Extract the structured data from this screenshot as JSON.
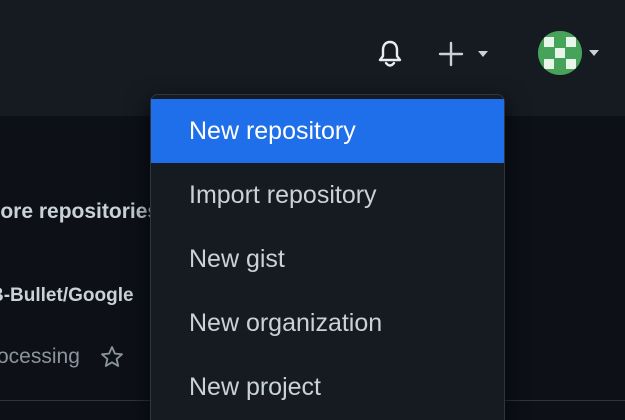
{
  "header": {
    "notifications_icon": "bell-icon",
    "create_icon": "plus-icon",
    "create_caret_icon": "caret-down-icon",
    "avatar_icon": "identicon-avatar",
    "avatar_caret_icon": "caret-down-icon"
  },
  "create_menu": {
    "items": [
      {
        "label": "New repository",
        "active": true
      },
      {
        "label": "Import repository"
      },
      {
        "label": "New gist"
      },
      {
        "label": "New organization"
      },
      {
        "label": "New project"
      }
    ]
  },
  "background": {
    "section_heading": "Explore repositories",
    "repo_name": "B-Bullet/Google",
    "repo_language": "Processing",
    "star_icon": "star-icon"
  },
  "colors": {
    "header_bg": "#161b22",
    "page_bg": "#0d1117",
    "menu_active": "#1f6feb",
    "avatar_green": "#47a35a"
  }
}
